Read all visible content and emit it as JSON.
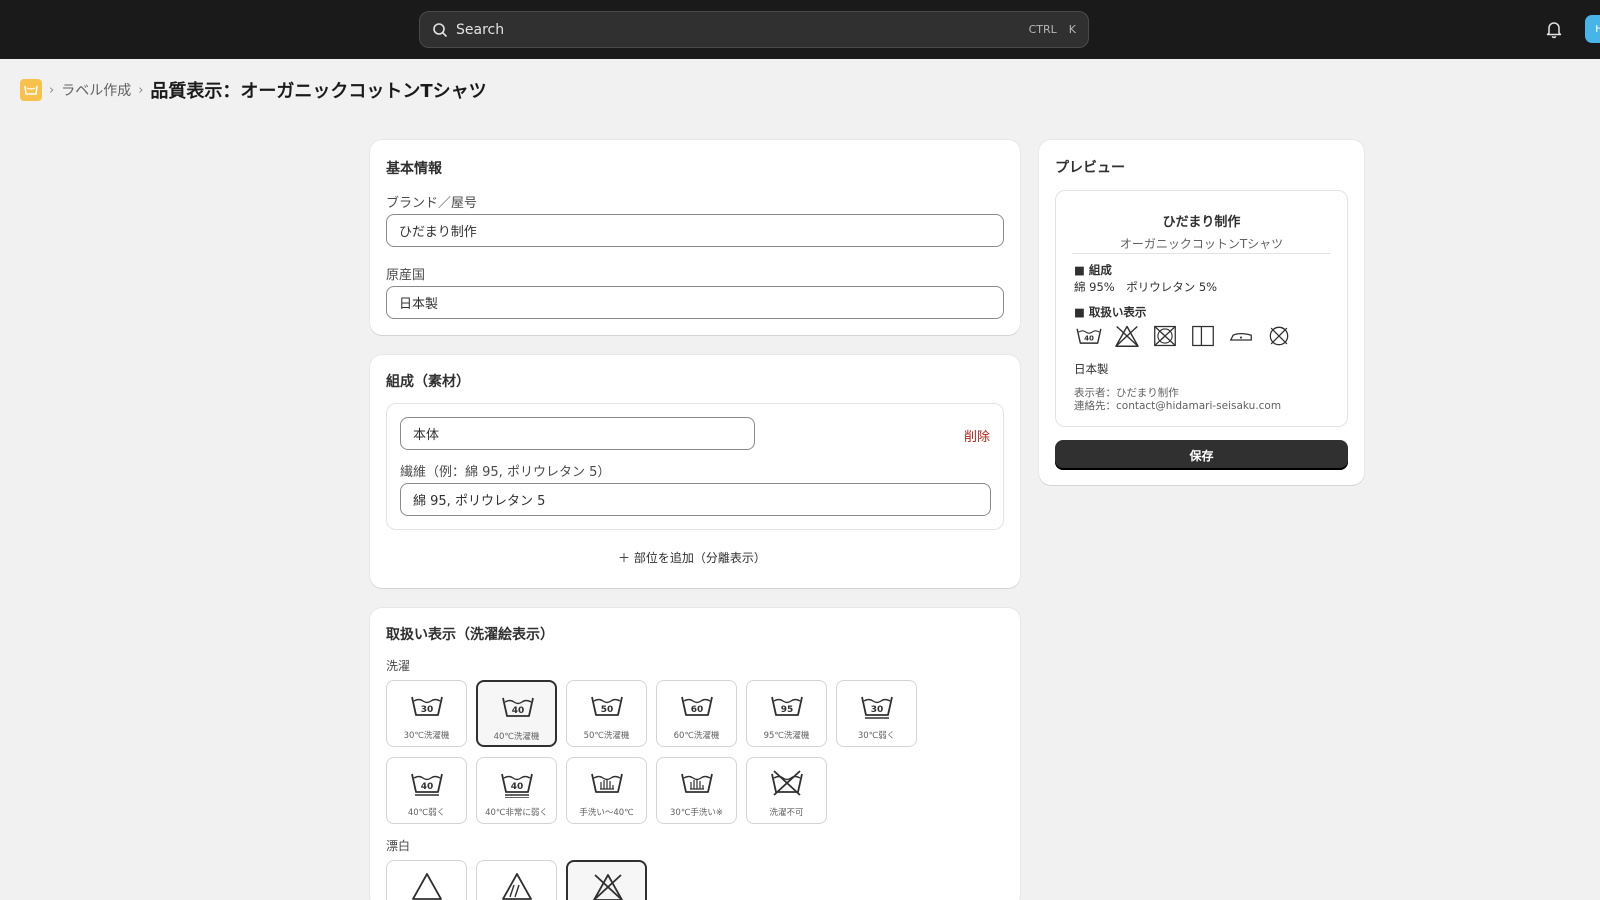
{
  "topbar": {
    "search_placeholder": "Search",
    "shortcut_ctrl": "CTRL",
    "shortcut_key": "K",
    "avatar_initial": "H"
  },
  "breadcrumb": {
    "parent": "ラベル作成",
    "title": "品質表示：オーガニックコットンTシャツ"
  },
  "basic": {
    "title": "基本情報",
    "brand_label": "ブランド／屋号",
    "brand_value": "ひだまり制作",
    "origin_label": "原産国",
    "origin_value": "日本製"
  },
  "composition": {
    "title": "組成（素材）",
    "part_value": "本体",
    "delete_label": "削除",
    "fiber_label": "繊維（例：綿 95, ポリウレタン 5）",
    "fiber_value": "綿 95, ポリウレタン 5",
    "add_part_label": "＋ 部位を追加（分離表示）"
  },
  "care": {
    "title": "取扱い表示（洗濯絵表示）",
    "wash_label": "洗濯",
    "bleach_label": "漂白",
    "wash_tiles": [
      {
        "label": "30℃洗濯機",
        "temp": "30",
        "selected": false
      },
      {
        "label": "40℃洗濯機",
        "temp": "40",
        "selected": true
      },
      {
        "label": "50℃洗濯機",
        "temp": "50",
        "selected": false
      },
      {
        "label": "60℃洗濯機",
        "temp": "60",
        "selected": false
      },
      {
        "label": "95℃洗濯機",
        "temp": "95",
        "selected": false
      },
      {
        "label": "30℃弱く",
        "temp": "30",
        "selected": false
      },
      {
        "label": "40℃弱く",
        "temp": "40",
        "selected": false
      },
      {
        "label": "40℃非常に弱く",
        "temp": "40",
        "selected": false
      },
      {
        "label": "手洗い〜40℃",
        "temp": "",
        "selected": false
      },
      {
        "label": "30℃手洗い※",
        "temp": "",
        "selected": false
      },
      {
        "label": "洗濯不可",
        "temp": "",
        "selected": false
      }
    ],
    "bleach_tiles": [
      {
        "icon": "bleach-allowed-icon",
        "selected": false
      },
      {
        "icon": "oxygen-bleach-icon",
        "selected": false
      },
      {
        "icon": "no-bleach-icon",
        "selected": true
      }
    ]
  },
  "preview": {
    "title": "プレビュー",
    "brand": "ひだまり制作",
    "product": "オーガニックコットンTシャツ",
    "composition_heading": "■ 組成",
    "composition_text": "綿 95%　ポリウレタン 5%",
    "care_heading": "■ 取扱い表示",
    "care_symbol_icons": [
      "wash-40-icon",
      "no-bleach-icon",
      "no-tumble-dry-icon",
      "line-dry-icon",
      "iron-low-icon",
      "no-dry-clean-icon"
    ],
    "wash_temp": "40",
    "origin": "日本製",
    "labeler": "表示者：ひだまり制作",
    "contact": "連絡先：contact@hidamari-seisaku.com",
    "save_label": "保存"
  }
}
